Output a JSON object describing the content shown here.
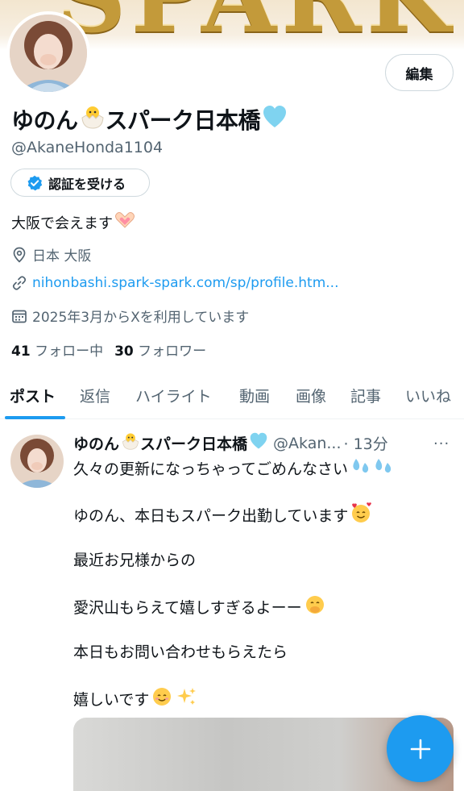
{
  "banner": {
    "text": "SPARK"
  },
  "profile": {
    "name": "ゆのん",
    "name_suffix": "スパーク日本橋",
    "handle": "@AkaneHonda1104",
    "edit_label": "編集",
    "verify_label": "認証を受ける",
    "bio": "大阪で会えます",
    "location": "日本 大阪",
    "website": "nihonbashi.spark-spark.com/sp/profile.htm...",
    "joined": "2025年3月からXを利用しています",
    "following_count": "41",
    "following_label": "フォロー中",
    "followers_count": "30",
    "followers_label": "フォロワー"
  },
  "tabs": [
    "ポスト",
    "返信",
    "ハイライト",
    "動画",
    "画像",
    "記事",
    "いいね"
  ],
  "post": {
    "name": "ゆのん",
    "name_suffix": "スパーク日本橋",
    "handle": "@Akan...",
    "time": "· 13分",
    "more": "···",
    "lines": [
      "久々の更新になっちゃってごめんなさい",
      "ゆのん、本日もスパーク出勤しています",
      "最近お兄様からの",
      "愛沢山もらえて嬉しすぎるよーー",
      "本日もお問い合わせもらえたら",
      "嬉しいです"
    ]
  },
  "icons": {
    "location": "location-pin-icon",
    "link": "link-icon",
    "calendar": "calendar-icon",
    "verified": "verified-badge-icon",
    "compose": "plus-icon"
  },
  "colors": {
    "accent": "#1d9bf0",
    "text": "#0f1419",
    "muted": "#536471",
    "border": "#cfd9de"
  }
}
